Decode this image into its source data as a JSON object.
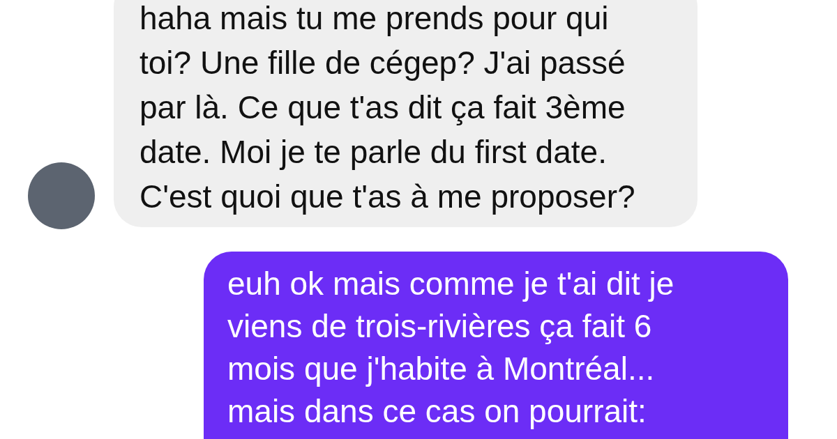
{
  "messages": [
    {
      "kind": "incoming",
      "text": "haha mais tu me prends pour qui\ntoi? Une fille de cégep? J'ai passé\npar là. Ce que t'as dit ça fait 3ème\ndate. Moi je te parle du first date.\nC'est quoi que t'as à me proposer?"
    },
    {
      "kind": "outgoing",
      "text": "euh ok mais comme je t'ai dit je\nviens de trois-rivières ça fait 6\nmois que j'habite à Montréal...\nmais dans ce cas on pourrait:"
    }
  ]
}
